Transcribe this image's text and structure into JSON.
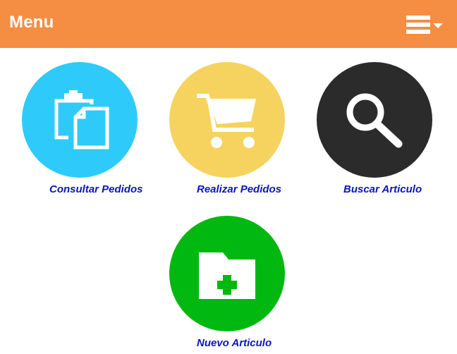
{
  "header": {
    "title": "Menu",
    "menu_icon": "hamburger-menu-icon",
    "background": "#f58d42"
  },
  "tiles": [
    {
      "label": "Consultar Pedidos",
      "icon": "clipboard-documents-icon",
      "color": "#2ecbfa"
    },
    {
      "label": "Realizar Pedidos",
      "icon": "shopping-cart-icon",
      "color": "#f6d35e"
    },
    {
      "label": "Buscar Articulo",
      "icon": "magnifier-icon",
      "color": "#2b2b2b"
    },
    {
      "label": "Nuevo Articulo",
      "icon": "folder-plus-icon",
      "color": "#00b80f"
    }
  ],
  "label_color": "#0a16b8"
}
